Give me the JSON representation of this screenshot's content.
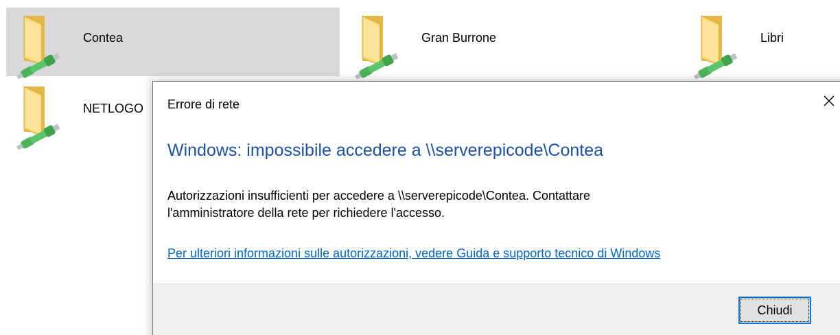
{
  "colors": {
    "selected_tile_bg": "#d9d9d9",
    "instruction_blue": "#1e51a5",
    "link_blue": "#0066cc",
    "button_focus_border": "#0078d7",
    "footer_bg": "#f0f0f0",
    "folder_yellow": "#f5cc5c",
    "network_cable_green": "#3fa34d"
  },
  "shares": [
    {
      "label": "Contea",
      "icon": "network-share-folder-icon",
      "selected": true
    },
    {
      "label": "Gran Burrone",
      "icon": "network-share-folder-icon",
      "selected": false
    },
    {
      "label": "Libri",
      "icon": "network-share-folder-icon",
      "selected": false
    },
    {
      "label": "NETLOGO",
      "icon": "network-share-folder-icon",
      "selected": false
    }
  ],
  "dialog": {
    "title": "Errore di rete",
    "close_icon": "close-icon",
    "main_instruction": "Windows: impossibile accedere a \\\\serverepicode\\Contea",
    "body_line1": "Autorizzazioni insufficienti per accedere a \\\\serverepicode\\Contea. Contattare",
    "body_line2": "l'amministratore della rete per richiedere l'accesso.",
    "help_link": "Per ulteriori informazioni sulle autorizzazioni, vedere Guida e supporto tecnico di Windows",
    "close_button_label": "Chiudi"
  }
}
